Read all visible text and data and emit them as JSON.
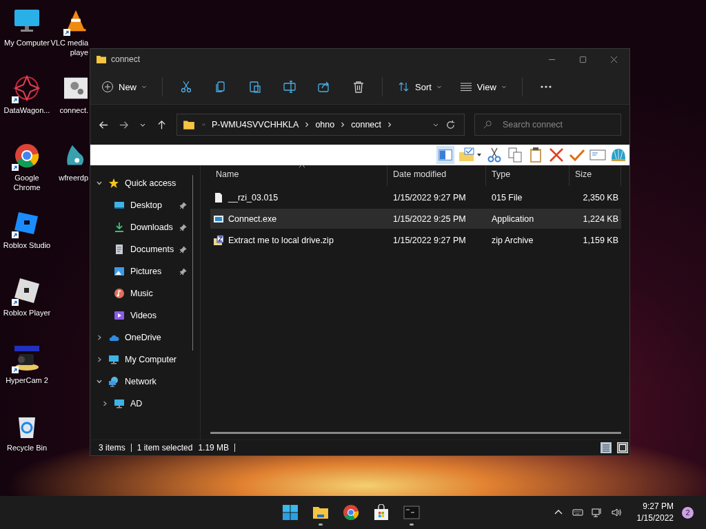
{
  "desktop": {
    "columns": [
      {
        "icons": [
          {
            "kind": "monitor",
            "lines": [
              "My Computer"
            ],
            "shortcut": false
          },
          {
            "kind": "star",
            "lines": [
              "DataWagon..."
            ],
            "shortcut": true
          },
          {
            "kind": "chrome",
            "lines": [
              "Google",
              "Chrome"
            ],
            "shortcut": true
          },
          {
            "kind": "studio",
            "lines": [
              "Roblox Studio"
            ],
            "shortcut": true
          },
          {
            "kind": "player",
            "lines": [
              "Roblox Player"
            ],
            "shortcut": true
          },
          {
            "kind": "camera",
            "lines": [
              "HyperCam 2"
            ],
            "shortcut": true
          },
          {
            "kind": "bin",
            "lines": [
              "Recycle Bin"
            ],
            "shortcut": false
          }
        ]
      },
      {
        "icons": [
          {
            "kind": "cone",
            "lines": [
              "VLC media",
              "playe"
            ],
            "shortcut": true
          },
          {
            "kind": "gears",
            "lines": [
              "connect."
            ],
            "shortcut": false
          },
          {
            "kind": "mascot",
            "lines": [
              "wfreerdp"
            ],
            "shortcut": false
          }
        ]
      }
    ]
  },
  "window": {
    "title": "connect"
  },
  "toolbar": {
    "new": "New",
    "sort": "Sort",
    "view": "View"
  },
  "address": {
    "crumbs": [
      "P-WMU4SVVCHHKLA",
      "ohno",
      "connect"
    ],
    "search": {
      "placeholder": "Search connect"
    }
  },
  "sidebar": {
    "items": [
      {
        "label": "Quick access",
        "kind": "star",
        "expanded": true,
        "children": [
          {
            "label": "Desktop",
            "kind": "desktop",
            "pinned": true
          },
          {
            "label": "Downloads",
            "kind": "download",
            "pinned": true
          },
          {
            "label": "Documents",
            "kind": "document",
            "pinned": true
          },
          {
            "label": "Pictures",
            "kind": "pictures",
            "pinned": true
          },
          {
            "label": "Music",
            "kind": "music",
            "pinned": false
          },
          {
            "label": "Videos",
            "kind": "videos",
            "pinned": false
          }
        ]
      },
      {
        "label": "OneDrive",
        "kind": "cloud",
        "expanded": false
      },
      {
        "label": "My Computer",
        "kind": "monitor",
        "expanded": false
      },
      {
        "label": "Network",
        "kind": "network",
        "expanded": true,
        "children": [
          {
            "label": "AD",
            "kind": "monitor",
            "expanded": false
          }
        ]
      }
    ]
  },
  "table": {
    "columns": [
      "Name",
      "Date modified",
      "Type",
      "Size"
    ],
    "rows": [
      {
        "kind": "file",
        "name": "__rzi_03.015",
        "date": "1/15/2022 9:27 PM",
        "type": "015 File",
        "size": "2,350 KB",
        "selected": false
      },
      {
        "kind": "exe",
        "name": "Connect.exe",
        "date": "1/15/2022 9:25 PM",
        "type": "Application",
        "size": "1,224 KB",
        "selected": true
      },
      {
        "kind": "zip",
        "name": "Extract me to local drive.zip",
        "date": "1/15/2022 9:27 PM",
        "type": "zip Archive",
        "size": "1,159 KB",
        "selected": false
      }
    ]
  },
  "status_bar": {
    "count": "3 items",
    "selection": "1 item selected",
    "size": "1.19 MB"
  },
  "taskbar": {
    "apps": [
      {
        "kind": "start",
        "running": false
      },
      {
        "kind": "explorer",
        "running": true
      },
      {
        "kind": "chrome",
        "running": false
      },
      {
        "kind": "store",
        "running": false
      },
      {
        "kind": "terminal",
        "running": true
      }
    ],
    "time": "9:27 PM",
    "date": "1/15/2022",
    "badge": "2"
  }
}
